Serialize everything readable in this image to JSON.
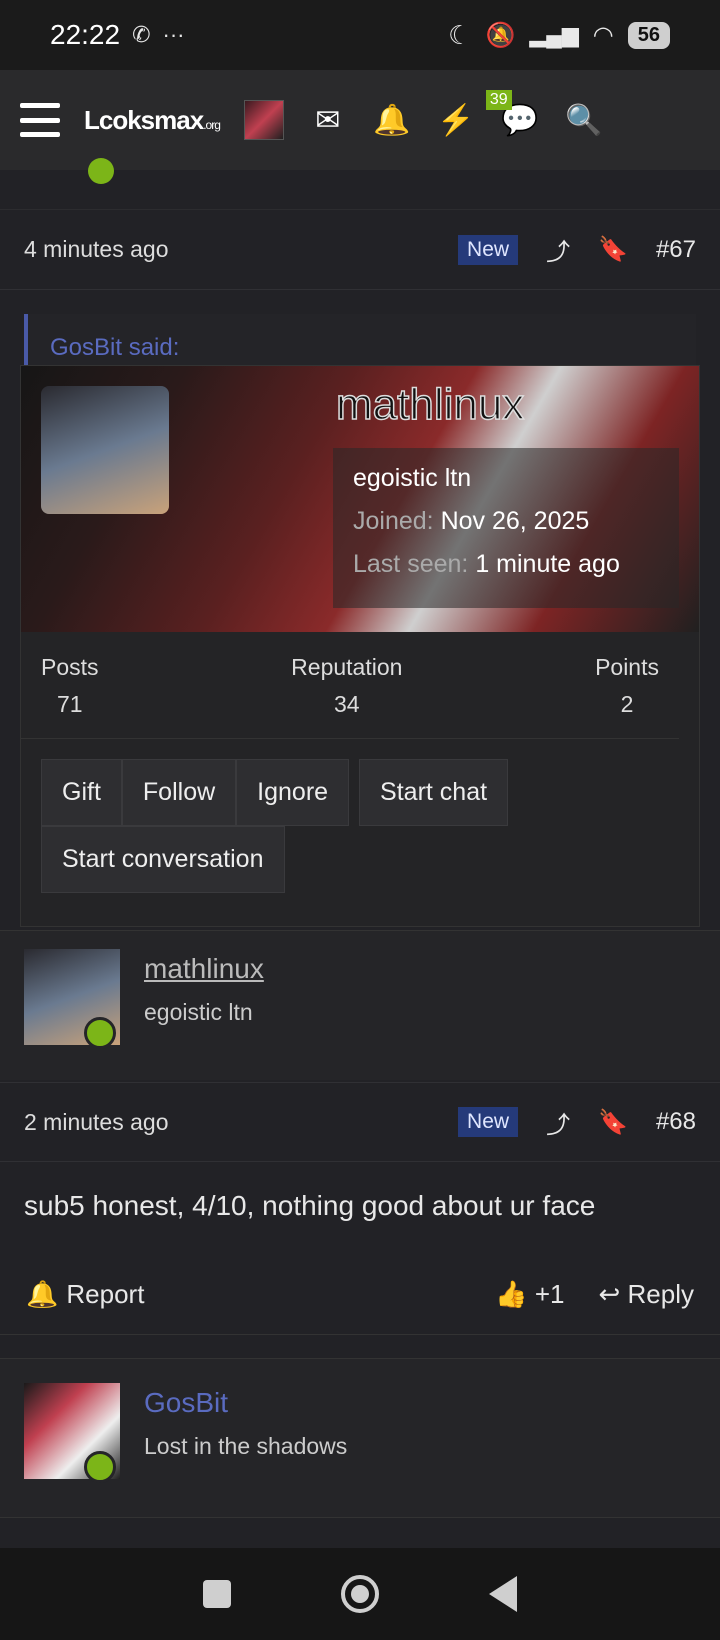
{
  "status": {
    "time": "22:22",
    "battery": "56"
  },
  "nav": {
    "logo_main": "Lcoksmax",
    "logo_suffix": ".org",
    "notif_count": "39"
  },
  "post67": {
    "time": "4 minutes ago",
    "badge": "New",
    "number": "#67",
    "quote": "GosBit said:"
  },
  "card": {
    "name": "mathlinux",
    "title": "egoistic ltn",
    "joined_label": "Joined:",
    "joined_value": "Nov 26, 2025",
    "seen_label": "Last seen:",
    "seen_value": "1 minute ago",
    "stats": [
      {
        "label": "Posts",
        "value": "71"
      },
      {
        "label": "Reputation",
        "value": "34"
      },
      {
        "label": "Points",
        "value": "2"
      }
    ],
    "buttons": [
      "Gift",
      "Follow",
      "Ignore",
      "Start chat",
      "Start conversation"
    ]
  },
  "post68": {
    "username": "mathlinux",
    "usertitle": "egoistic ltn",
    "time": "2 minutes ago",
    "badge": "New",
    "number": "#68",
    "body": "sub5 honest, 4/10, nothing good about ur face",
    "report": "Report",
    "likes": "+1",
    "reply": "Reply"
  },
  "post69": {
    "username": "GosBit",
    "usertitle": "Lost in the shadows"
  },
  "colors": {
    "accent": "#7cb518",
    "link": "#5a6bc0",
    "new_badge": "#253a7a"
  }
}
